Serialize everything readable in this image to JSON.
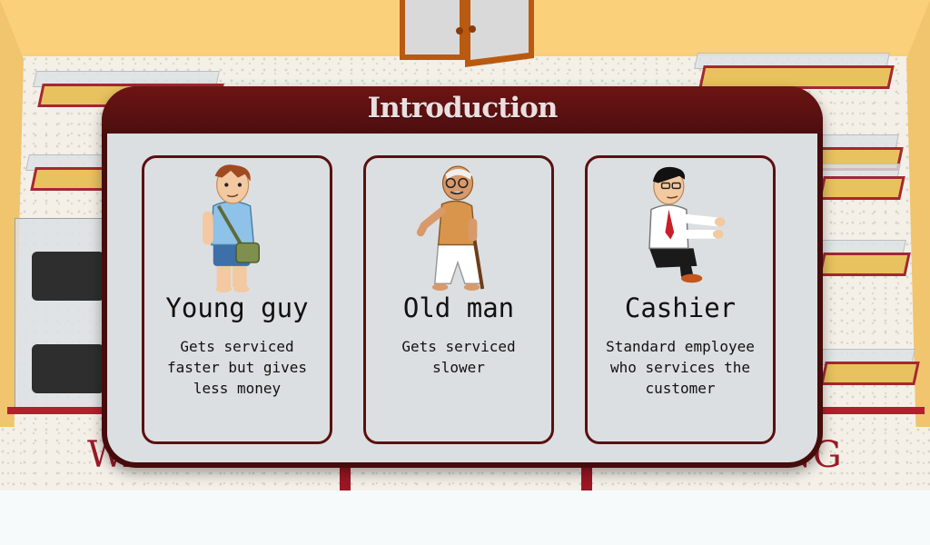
{
  "dialog": {
    "title": "Introduction"
  },
  "cards": [
    {
      "name": "Young guy",
      "description": "Gets serviced faster but gives less money",
      "icon": "young-guy-icon"
    },
    {
      "name": "Old man",
      "description": "Gets serviced slower",
      "icon": "old-man-icon"
    },
    {
      "name": "Cashier",
      "description": "Standard employee who services the customer",
      "icon": "cashier-icon"
    }
  ],
  "scene": {
    "floor_left_word": "WA",
    "floor_right_word": "ING"
  },
  "colors": {
    "dialog_frame": "#460c0c",
    "dialog_panel": "#dcdfe1",
    "card_border": "#5a1010",
    "wall": "#fbd07a",
    "floor_accent": "#b21f2d"
  }
}
